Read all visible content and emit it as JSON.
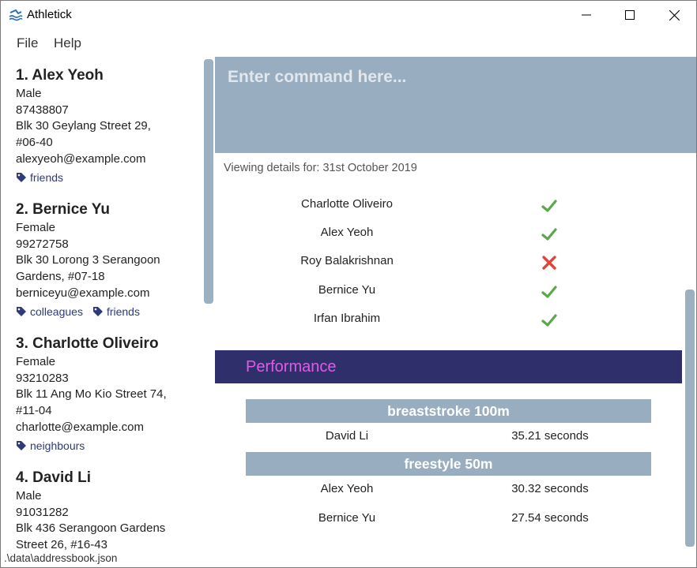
{
  "window": {
    "title": "Athletick",
    "icon": "athletick-swimmer-icon"
  },
  "menu": {
    "file_label": "File",
    "help_label": "Help"
  },
  "persons": [
    {
      "index_name": "1.  Alex Yeoh",
      "gender": "Male",
      "phone": "87438807",
      "address_line1": "Blk 30 Geylang Street 29,",
      "address_line2": "#06-40",
      "email": "alexyeoh@example.com",
      "tags": [
        "friends"
      ]
    },
    {
      "index_name": "2.  Bernice Yu",
      "gender": "Female",
      "phone": "99272758",
      "address_line1": "Blk 30 Lorong 3 Serangoon",
      "address_line2": "Gardens, #07-18",
      "email": "berniceyu@example.com",
      "tags": [
        "colleagues",
        "friends"
      ]
    },
    {
      "index_name": "3.  Charlotte Oliveiro",
      "gender": "Female",
      "phone": "93210283",
      "address_line1": "Blk 11 Ang Mo Kio Street 74,",
      "address_line2": "#11-04",
      "email": "charlotte@example.com",
      "tags": [
        "neighbours"
      ]
    },
    {
      "index_name": "4.  David Li",
      "gender": "Male",
      "phone": "91031282",
      "address_line1": "Blk 436 Serangoon Gardens",
      "address_line2": "Street 26, #16-43"
    }
  ],
  "command": {
    "placeholder": "Enter command here..."
  },
  "details": {
    "viewing_label": "Viewing details for: 31st October 2019",
    "attendance": [
      {
        "name": "Charlotte Oliveiro",
        "present": true
      },
      {
        "name": "Alex Yeoh",
        "present": true
      },
      {
        "name": "Roy Balakrishnan",
        "present": false
      },
      {
        "name": "Bernice Yu",
        "present": true
      },
      {
        "name": "Irfan Ibrahim",
        "present": true
      }
    ],
    "performance_title": "Performance",
    "events": [
      {
        "name": "breaststroke 100m",
        "results": [
          {
            "name": "David Li",
            "time": "35.21 seconds"
          }
        ]
      },
      {
        "name": "freestyle 50m",
        "results": [
          {
            "name": "Alex Yeoh",
            "time": "30.32 seconds"
          },
          {
            "name": "Bernice Yu",
            "time": "27.54 seconds"
          }
        ]
      }
    ]
  },
  "status": {
    "file_path": ".\\data\\addressbook.json"
  },
  "colors": {
    "accent": "#98aec0",
    "performance_header": "#2f2f6b",
    "performance_text": "#e25ae8",
    "present": "#5aa84a",
    "absent": "#e0443a",
    "tag": "#2e3a7a"
  }
}
